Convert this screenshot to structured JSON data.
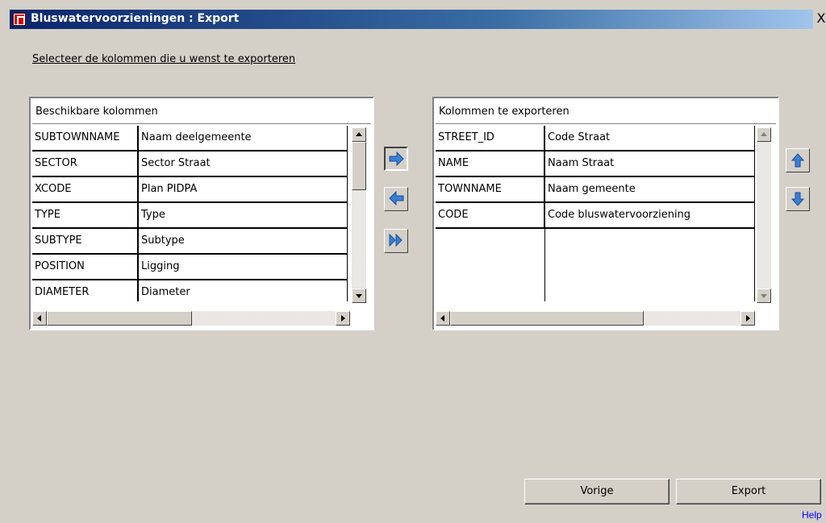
{
  "window": {
    "title": "Bluswatervoorzieningen : Export",
    "close_label": "X"
  },
  "instruction": "Selecteer de kolommen die u wenst te exporteren",
  "available": {
    "header": "Beschikbare kolommen",
    "rows": [
      {
        "code": "SUBTOWNNAME",
        "label": "Naam deelgemeente"
      },
      {
        "code": "SECTOR",
        "label": "Sector Straat"
      },
      {
        "code": "XCODE",
        "label": "Plan PIDPA"
      },
      {
        "code": "TYPE",
        "label": "Type"
      },
      {
        "code": "SUBTYPE",
        "label": "Subtype"
      },
      {
        "code": "POSITION",
        "label": "Ligging"
      },
      {
        "code": "DIAMETER",
        "label": "Diameter"
      }
    ]
  },
  "selected": {
    "header": "Kolommen te exporteren",
    "rows": [
      {
        "code": "STREET_ID",
        "label": "Code Straat"
      },
      {
        "code": "NAME",
        "label": "Naam Straat"
      },
      {
        "code": "TOWNNAME",
        "label": "Naam gemeente"
      },
      {
        "code": "CODE",
        "label": "Code bluswatervoorziening"
      }
    ]
  },
  "transfer_buttons": {
    "add": "arrow-right-icon",
    "remove": "arrow-left-icon",
    "add_all": "double-arrow-right-icon"
  },
  "order_buttons": {
    "up": "arrow-up-icon",
    "down": "arrow-down-icon"
  },
  "footer": {
    "previous_label": "Vorige",
    "export_label": "Export",
    "help_label": "Help"
  },
  "colors": {
    "icon_blue": "#3a7fd6",
    "titlebar_dark": "#0a246a",
    "face": "#d4d0c8"
  }
}
